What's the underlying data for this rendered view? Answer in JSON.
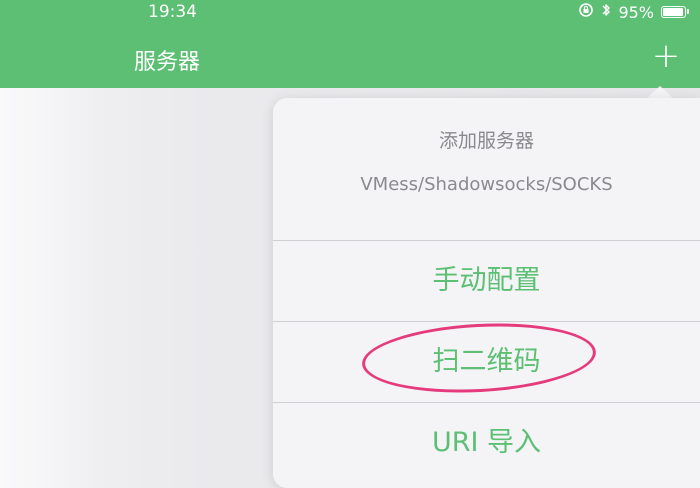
{
  "status_bar": {
    "time": "19:34",
    "battery_text": "95%",
    "battery_level": 0.95,
    "icons": [
      "rotation-lock-icon",
      "bluetooth-icon",
      "battery-icon"
    ]
  },
  "nav": {
    "title": "服务器",
    "add_label": "+"
  },
  "popover": {
    "title": "添加服务器",
    "subtitle": "VMess/Shadowsocks/SOCKS",
    "actions": [
      {
        "label": "手动配置"
      },
      {
        "label": "扫二维码"
      },
      {
        "label": "URI 导入"
      }
    ]
  },
  "colors": {
    "accent": "#5cbf74",
    "highlight": "#e53b7c",
    "background": "#e9e9ec",
    "popover": "#f4f4f6"
  }
}
